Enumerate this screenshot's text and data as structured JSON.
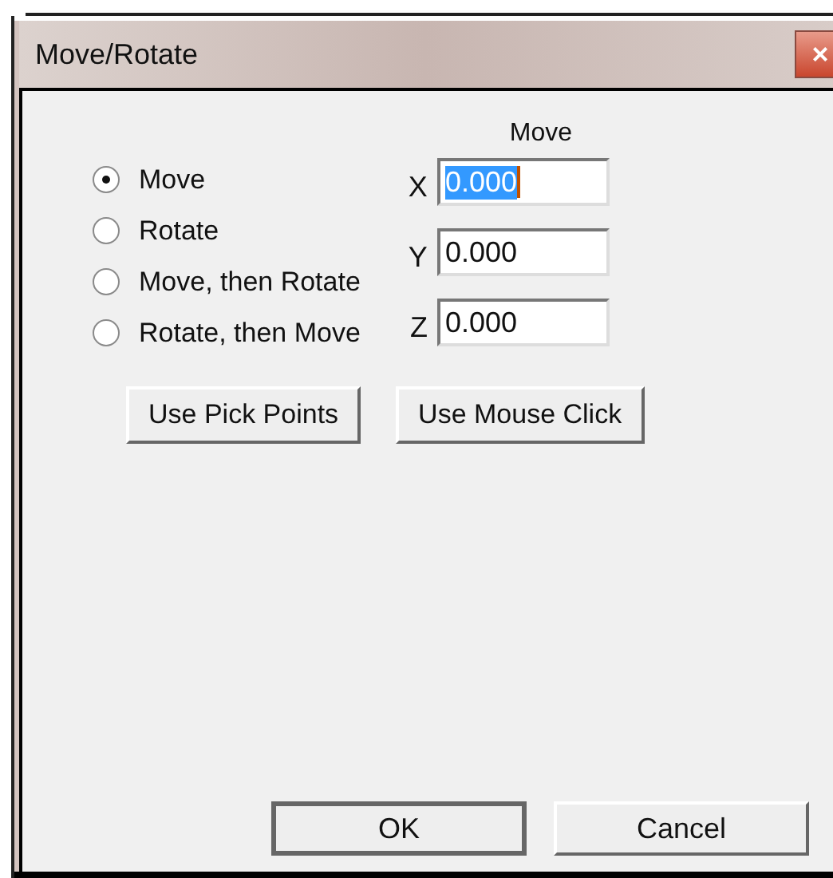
{
  "window": {
    "title": "Move/Rotate",
    "close": "×"
  },
  "modes": [
    {
      "label": "Move",
      "selected": true
    },
    {
      "label": "Rotate",
      "selected": false
    },
    {
      "label": "Move, then Rotate",
      "selected": false
    },
    {
      "label": "Rotate, then Move",
      "selected": false
    }
  ],
  "move_heading": "Move",
  "fields": [
    {
      "label": "X",
      "value": "0.000",
      "focused": true
    },
    {
      "label": "Y",
      "value": "0.000",
      "focused": false
    },
    {
      "label": "Z",
      "value": "0.000",
      "focused": false
    }
  ],
  "pick_buttons": [
    "Use Pick Points",
    "Use Mouse Click"
  ],
  "buttons": [
    "OK",
    "Cancel"
  ]
}
